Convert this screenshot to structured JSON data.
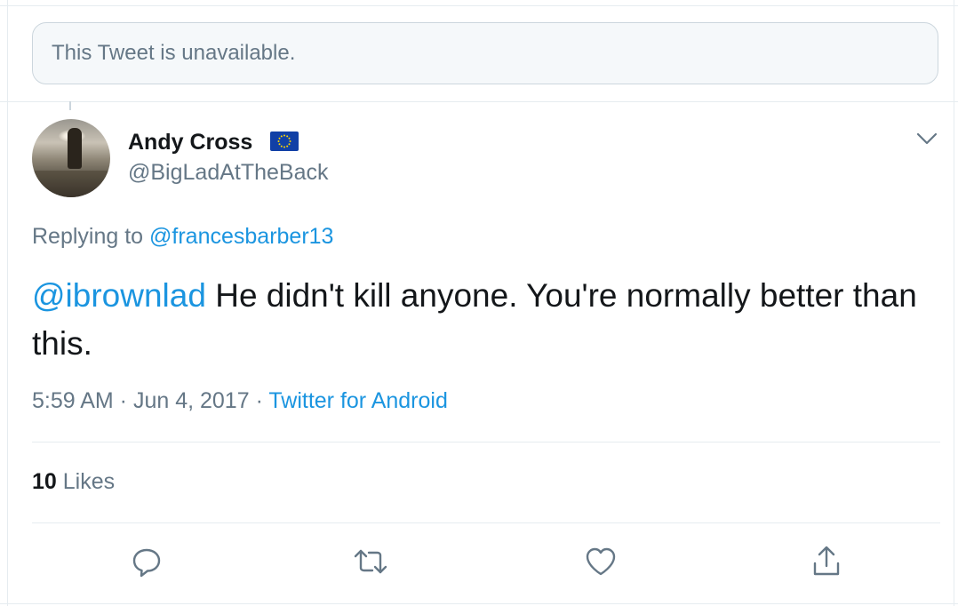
{
  "unavailable_notice": {
    "text": "This Tweet is unavailable."
  },
  "author": {
    "name": "Andy Cross",
    "handle": "@BigLadAtTheBack",
    "badge_icon": "eu-flag-icon"
  },
  "reply": {
    "prefix": "Replying to ",
    "target": "@francesbarber13"
  },
  "tweet": {
    "mention": "@ibrownlad",
    "text": " He didn't kill anyone. You're normally better than this."
  },
  "meta": {
    "time": "5:59 AM",
    "separator_1": " · ",
    "date": "Jun 4, 2017",
    "separator_2": " · ",
    "source": "Twitter for Android"
  },
  "stats": {
    "likes_count": "10",
    "likes_label": " Likes"
  },
  "actions": [
    {
      "icon": "reply-icon"
    },
    {
      "icon": "retweet-icon"
    },
    {
      "icon": "like-icon"
    },
    {
      "icon": "share-icon"
    }
  ],
  "colors": {
    "link": "#1b95e0",
    "secondary_text": "#657786",
    "primary_text": "#14171a",
    "border": "#e6ecf0",
    "eu_blue": "#1140a6",
    "eu_stars": "#ffd700"
  }
}
